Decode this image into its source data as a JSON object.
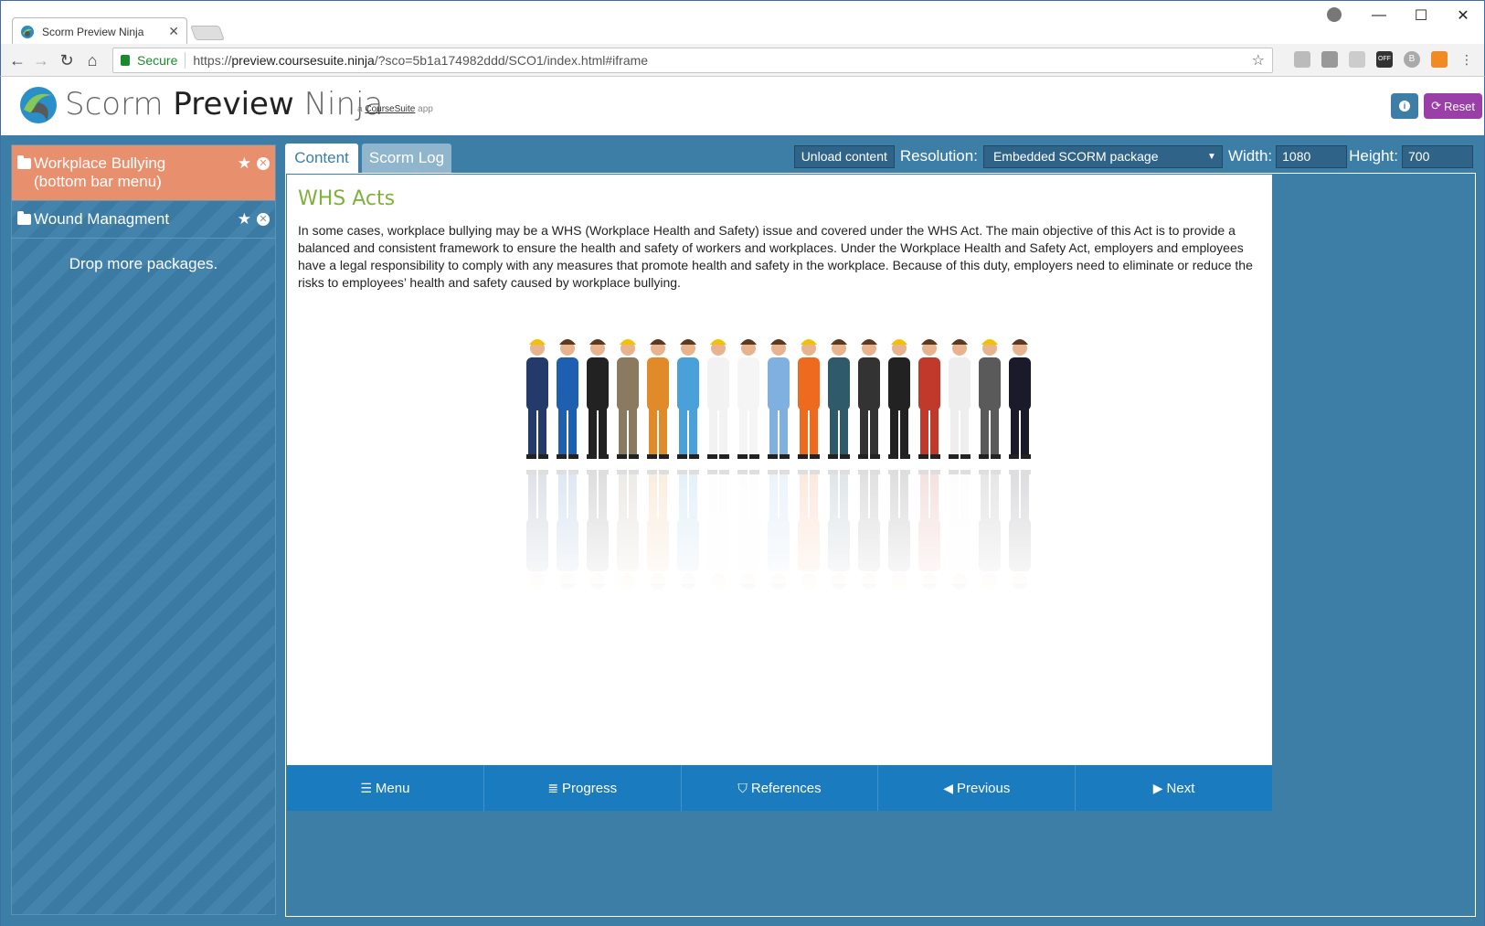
{
  "browser": {
    "tab_title": "Scorm Preview Ninja",
    "tab_close": "✕",
    "secure_label": "Secure",
    "url_prefix": "https://",
    "url_host": "preview.coursesuite.ninja",
    "url_path": "/?sco=5b1a174982ddd/SCO1/index.html#iframe",
    "ext_off_label": "OFF",
    "ext_b_label": "B"
  },
  "app": {
    "brand_scorm": "Scorm",
    "brand_preview": "Preview",
    "brand_ninja": "Ninja",
    "sub_prefix": "a",
    "sub_link": "CourseSuite",
    "sub_suffix": "app",
    "info_label": "i",
    "reset_label": "Reset"
  },
  "sidebar": {
    "packages": [
      {
        "label": "Workplace Bullying (bottom bar menu)",
        "active": true
      },
      {
        "label": "Wound Managment",
        "active": false
      }
    ],
    "drop_text": "Drop more packages."
  },
  "tabs": {
    "content": "Content",
    "scorm_log": "Scorm Log"
  },
  "controls": {
    "unload_label": "Unload content",
    "resolution_label": "Resolution:",
    "resolution_value": "Embedded SCORM package",
    "width_label": "Width:",
    "width_value": "1080",
    "height_label": "Height:",
    "height_value": "700"
  },
  "lesson": {
    "title": "WHS Acts",
    "body": "In some cases, workplace bullying may be a WHS (Workplace Health and Safety) issue and covered under the WHS Act. The main objective of this Act is to provide a balanced and consistent framework to ensure the health and safety of workers and workplaces. Under the Workplace Health and Safety Act, employers and employees have a legal responsibility to comply with any measures that promote health and safety in the workplace. Because of this duty, employers need to eliminate or reduce the risks to employees’ health and safety caused by workplace bullying."
  },
  "bottom_bar": {
    "menu": "Menu",
    "progress": "Progress",
    "references": "References",
    "previous": "Previous",
    "next": "Next"
  },
  "colors": {
    "workspace": "#3d7ea6",
    "active_package": "#e8906e",
    "bottom_bar": "#1b7bbf",
    "title_green": "#7fb23d",
    "reset_button": "#9b3fa8"
  }
}
